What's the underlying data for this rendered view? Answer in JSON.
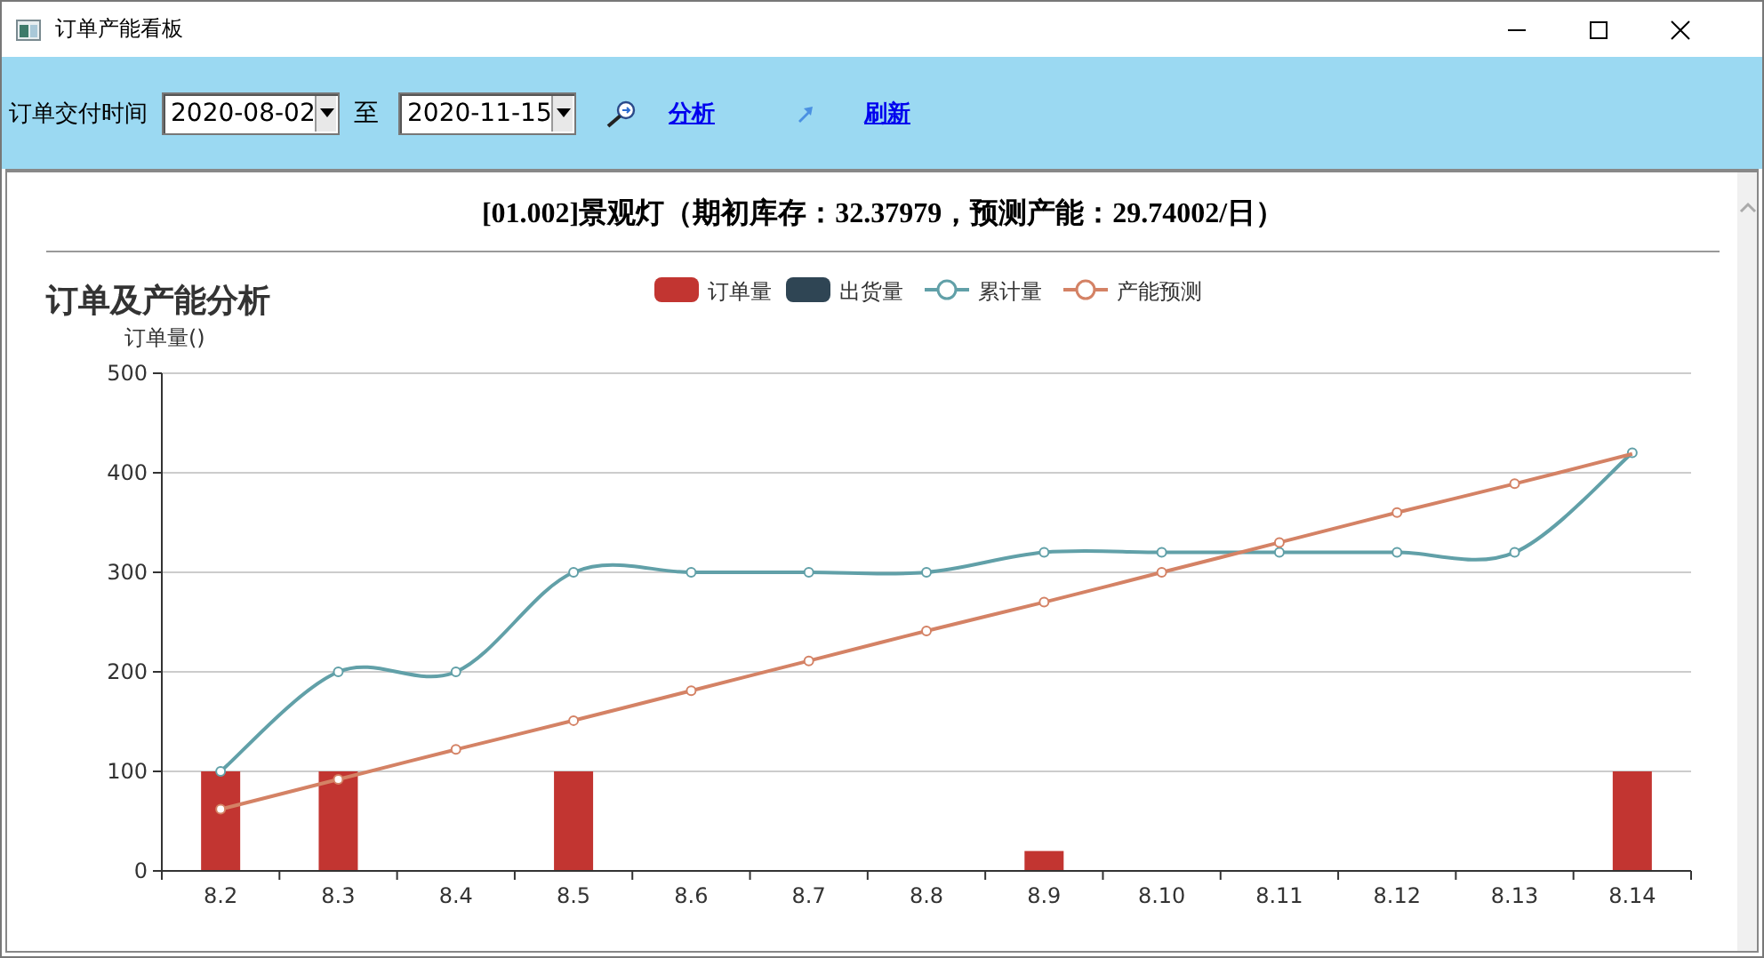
{
  "window": {
    "title": "订单产能看板"
  },
  "toolbar": {
    "date_label": "订单交付时间",
    "start_date": "2020-08-02",
    "separator": "至",
    "end_date": "2020-11-15",
    "analyze_link": "分析",
    "refresh_link": "刷新"
  },
  "header": "[01.002]景观灯（期初库存：32.37979，预测产能：29.74002/日）",
  "chart_data": {
    "type": "bar",
    "title": "订单及产能分析",
    "ylabel": "订单量()",
    "categories": [
      "8.2",
      "8.3",
      "8.4",
      "8.5",
      "8.6",
      "8.7",
      "8.8",
      "8.9",
      "8.10",
      "8.11",
      "8.12",
      "8.13",
      "8.14"
    ],
    "ylim": [
      0,
      500
    ],
    "grid": true,
    "legend": true,
    "yticks": [
      0,
      100,
      200,
      300,
      400,
      500
    ],
    "series": [
      {
        "name": "订单量",
        "type": "bar",
        "color": "#c23531",
        "values": [
          100,
          100,
          0,
          100,
          0,
          0,
          0,
          20,
          0,
          0,
          0,
          0,
          100
        ]
      },
      {
        "name": "出货量",
        "type": "bar",
        "color": "#2f4554",
        "values": [
          0,
          0,
          0,
          0,
          0,
          0,
          0,
          0,
          0,
          0,
          0,
          0,
          0
        ]
      },
      {
        "name": "累计量",
        "type": "line",
        "marker": "circle",
        "color": "#61a0a8",
        "values": [
          100,
          200,
          200,
          300,
          300,
          300,
          300,
          320,
          320,
          320,
          320,
          320,
          420
        ]
      },
      {
        "name": "产能预测",
        "type": "line",
        "marker": "circle",
        "color": "#d48265",
        "values": [
          62,
          92,
          122,
          151,
          181,
          211,
          241,
          270,
          300,
          330,
          360,
          389,
          419
        ]
      }
    ]
  }
}
